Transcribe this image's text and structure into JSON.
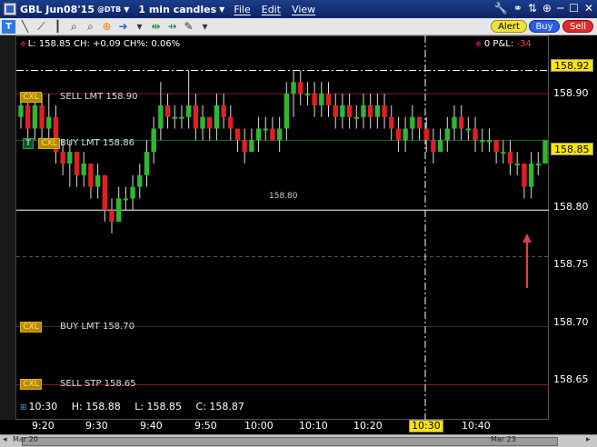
{
  "titlebar": {
    "symbol": "GBL Jun08'15",
    "exchange": "@DTB",
    "timeframe": "1 min candles",
    "menus": [
      "File",
      "Edit",
      "View"
    ]
  },
  "toolbar": {
    "alert": "Alert",
    "buy": "Buy",
    "sell": "Sell"
  },
  "infobar": {
    "text": "L: 158.85 CH: +0.09 CH%: 0.06%",
    "pnl_label": "0 P&L:",
    "pnl_value": "-34"
  },
  "orders": [
    {
      "cxl": "CXL",
      "label": "SELL LMT 158.90"
    },
    {
      "cxl": "CXL",
      "label": "BUY LMT 158.86",
      "transmit": "T"
    },
    {
      "cxl": "CXL",
      "label": "BUY LMT 158.70"
    },
    {
      "cxl": "CXL",
      "label": "SELL STP 158.65"
    }
  ],
  "price_marker": "158.80",
  "ohlc": {
    "time": "10:30",
    "high": "H: 158.88",
    "low": "L: 158.85",
    "close": "C: 158.87"
  },
  "y_axis": {
    "labels": [
      "158.90",
      "158.80",
      "158.75",
      "158.70",
      "158.65"
    ],
    "highlight_high": "158.92",
    "highlight_last": "158.85"
  },
  "x_axis": {
    "labels": [
      "9:20",
      "9:30",
      "9:40",
      "9:50",
      "10:00",
      "10:10",
      "10:20",
      "10:40"
    ],
    "cursor": "10:30"
  },
  "scroll": {
    "left_date": "Mar 20",
    "right_date": "Mar 23"
  },
  "colors": {
    "up": "#2eb82e",
    "down": "#e02020",
    "accent": "#ffe600"
  },
  "chart_data": {
    "type": "candlestick",
    "ylim": [
      158.62,
      158.95
    ],
    "candles": [
      [
        158.88,
        158.9,
        158.87,
        158.89
      ],
      [
        158.89,
        158.9,
        158.86,
        158.87
      ],
      [
        158.87,
        158.9,
        158.86,
        158.89
      ],
      [
        158.89,
        158.9,
        158.86,
        158.87
      ],
      [
        158.87,
        158.9,
        158.86,
        158.88
      ],
      [
        158.88,
        158.89,
        158.84,
        158.85
      ],
      [
        158.85,
        158.86,
        158.83,
        158.84
      ],
      [
        158.84,
        158.86,
        158.82,
        158.85
      ],
      [
        158.85,
        158.85,
        158.82,
        158.83
      ],
      [
        158.83,
        158.85,
        158.82,
        158.84
      ],
      [
        158.84,
        158.84,
        158.81,
        158.82
      ],
      [
        158.82,
        158.84,
        158.81,
        158.83
      ],
      [
        158.83,
        158.83,
        158.79,
        158.8
      ],
      [
        158.8,
        158.81,
        158.78,
        158.79
      ],
      [
        158.79,
        158.82,
        158.79,
        158.81
      ],
      [
        158.81,
        158.82,
        158.8,
        158.81
      ],
      [
        158.81,
        158.83,
        158.8,
        158.82
      ],
      [
        158.82,
        158.84,
        158.81,
        158.83
      ],
      [
        158.83,
        158.86,
        158.82,
        158.85
      ],
      [
        158.85,
        158.88,
        158.84,
        158.87
      ],
      [
        158.87,
        158.91,
        158.86,
        158.89
      ],
      [
        158.89,
        158.9,
        158.87,
        158.88
      ],
      [
        158.88,
        158.89,
        158.87,
        158.88
      ],
      [
        158.88,
        158.89,
        158.87,
        158.88
      ],
      [
        158.88,
        158.92,
        158.87,
        158.89
      ],
      [
        158.89,
        158.9,
        158.86,
        158.87
      ],
      [
        158.87,
        158.89,
        158.86,
        158.88
      ],
      [
        158.88,
        158.88,
        158.86,
        158.87
      ],
      [
        158.87,
        158.9,
        158.86,
        158.89
      ],
      [
        158.89,
        158.9,
        158.87,
        158.88
      ],
      [
        158.88,
        158.89,
        158.86,
        158.87
      ],
      [
        158.87,
        158.87,
        158.85,
        158.86
      ],
      [
        158.86,
        158.87,
        158.84,
        158.85
      ],
      [
        158.85,
        158.87,
        158.85,
        158.86
      ],
      [
        158.86,
        158.88,
        158.85,
        158.87
      ],
      [
        158.87,
        158.88,
        158.86,
        158.87
      ],
      [
        158.87,
        158.88,
        158.86,
        158.86
      ],
      [
        158.86,
        158.88,
        158.85,
        158.87
      ],
      [
        158.87,
        158.91,
        158.86,
        158.9
      ],
      [
        158.9,
        158.92,
        158.88,
        158.91
      ],
      [
        158.91,
        158.92,
        158.89,
        158.9
      ],
      [
        158.9,
        158.91,
        158.89,
        158.9
      ],
      [
        158.9,
        158.91,
        158.88,
        158.89
      ],
      [
        158.89,
        158.91,
        158.88,
        158.9
      ],
      [
        158.9,
        158.91,
        158.88,
        158.89
      ],
      [
        158.89,
        158.9,
        158.87,
        158.88
      ],
      [
        158.88,
        158.9,
        158.87,
        158.89
      ],
      [
        158.89,
        158.9,
        158.87,
        158.88
      ],
      [
        158.88,
        158.89,
        158.87,
        158.88
      ],
      [
        158.88,
        158.9,
        158.87,
        158.89
      ],
      [
        158.89,
        158.9,
        158.87,
        158.88
      ],
      [
        158.88,
        158.9,
        158.87,
        158.89
      ],
      [
        158.89,
        158.9,
        158.87,
        158.88
      ],
      [
        158.88,
        158.89,
        158.86,
        158.87
      ],
      [
        158.87,
        158.88,
        158.85,
        158.86
      ],
      [
        158.86,
        158.88,
        158.85,
        158.87
      ],
      [
        158.87,
        158.89,
        158.86,
        158.88
      ],
      [
        158.88,
        158.88,
        158.86,
        158.87
      ],
      [
        158.87,
        158.88,
        158.85,
        158.86
      ],
      [
        158.86,
        158.87,
        158.84,
        158.85
      ],
      [
        158.85,
        158.87,
        158.85,
        158.86
      ],
      [
        158.86,
        158.88,
        158.85,
        158.87
      ],
      [
        158.87,
        158.89,
        158.86,
        158.88
      ],
      [
        158.88,
        158.89,
        158.86,
        158.87
      ],
      [
        158.87,
        158.88,
        158.86,
        158.87
      ],
      [
        158.87,
        158.88,
        158.85,
        158.86
      ],
      [
        158.86,
        158.87,
        158.85,
        158.86
      ],
      [
        158.86,
        158.87,
        158.85,
        158.86
      ],
      [
        158.86,
        158.86,
        158.84,
        158.85
      ],
      [
        158.85,
        158.86,
        158.84,
        158.85
      ],
      [
        158.85,
        158.86,
        158.83,
        158.84
      ],
      [
        158.84,
        158.85,
        158.83,
        158.84
      ],
      [
        158.84,
        158.84,
        158.81,
        158.82
      ],
      [
        158.82,
        158.85,
        158.81,
        158.84
      ],
      [
        158.84,
        158.85,
        158.83,
        158.84
      ],
      [
        158.84,
        158.86,
        158.84,
        158.86
      ]
    ]
  }
}
